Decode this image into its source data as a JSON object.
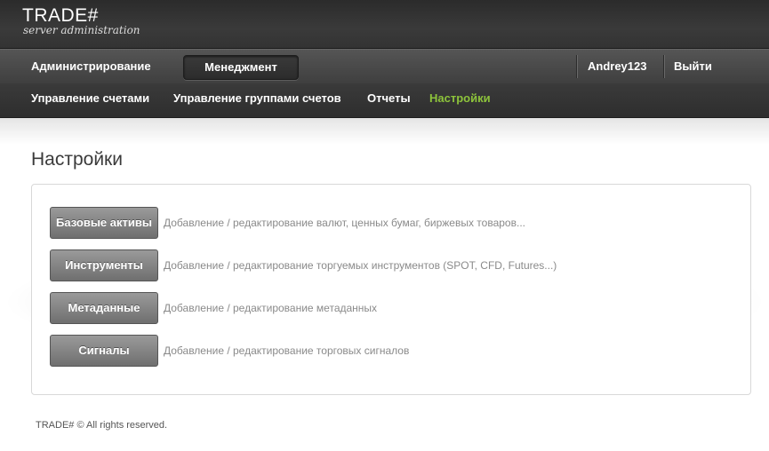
{
  "header": {
    "logo": "TRADE#",
    "tagline": "server administration"
  },
  "main_nav": {
    "items": [
      {
        "label": "Администрирование"
      },
      {
        "label": "Менеджмент"
      }
    ],
    "user": "Andrey123",
    "logout": "Выйти"
  },
  "sub_nav": {
    "items": [
      {
        "label": "Управление счетами"
      },
      {
        "label": "Управление группами счетов"
      },
      {
        "label": "Отчеты"
      },
      {
        "label": "Настройки"
      }
    ]
  },
  "page": {
    "title": "Настройки"
  },
  "settings": {
    "rows": [
      {
        "button": "Базовые активы",
        "description": "Добавление / редактирование валют, ценных бумаг, биржевых товаров..."
      },
      {
        "button": "Инструменты",
        "description": "Добавление / редактирование торгуемых инструментов (SPOT, CFD, Futures...)"
      },
      {
        "button": "Метаданные",
        "description": "Добавление / редактирование метаданных"
      },
      {
        "button": "Сигналы",
        "description": "Добавление / редактирование торговых сигналов"
      }
    ]
  },
  "footer": {
    "text": "TRADE# © All rights reserved."
  },
  "colors": {
    "active_nav": "#8dc33b",
    "header_bg": "#333333",
    "button_bg": "#808080"
  }
}
